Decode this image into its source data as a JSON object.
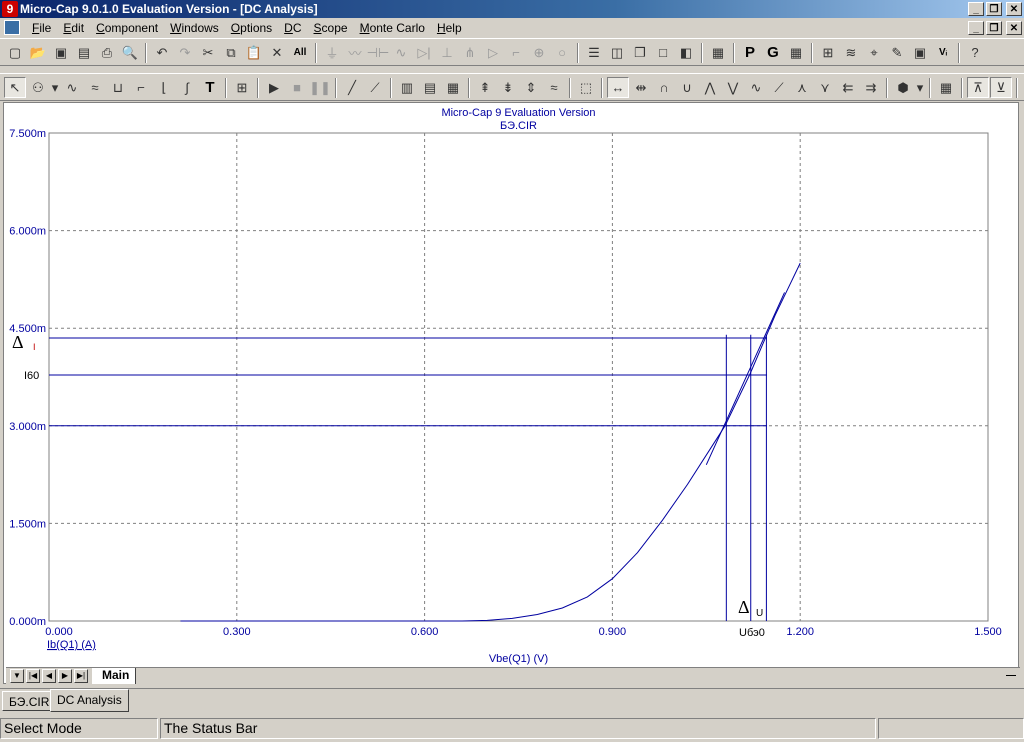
{
  "window": {
    "title": "Micro-Cap 9.0.1.0 Evaluation Version - [DC Analysis]",
    "app_icon_glyph": "9",
    "minimize_glyph": "_",
    "restore_glyph": "❐",
    "close_glyph": "✕"
  },
  "menu": {
    "items": [
      {
        "label": "File",
        "key": "F"
      },
      {
        "label": "Edit",
        "key": "E"
      },
      {
        "label": "Component",
        "key": "C"
      },
      {
        "label": "Windows",
        "key": "W"
      },
      {
        "label": "Options",
        "key": "O"
      },
      {
        "label": "DC",
        "key": "D"
      },
      {
        "label": "Scope",
        "key": "S"
      },
      {
        "label": "Monte Carlo",
        "key": "M"
      },
      {
        "label": "Help",
        "key": "H"
      }
    ]
  },
  "toolbar1": {
    "items": [
      "new-icon",
      "open-icon",
      "save-icon",
      "save-all-icon",
      "print-icon",
      "print-preview-icon",
      "sep",
      "undo-icon",
      "redo-icon",
      "cut-icon",
      "copy-icon",
      "paste-icon",
      "delete-icon",
      "select-all-icon",
      "sep",
      "ground-icon",
      "resistor-icon",
      "capacitor-icon",
      "inductor-icon",
      "diode-icon",
      "battery-icon",
      "npn-icon",
      "opamp-icon",
      "switch-icon",
      "source-icon",
      "wire-icon",
      "sep",
      "tile-h-icon",
      "tile-v-icon",
      "cascade-icon",
      "window-icon",
      "split-icon",
      "sep",
      "calculator-icon",
      "sep",
      "p-label-icon",
      "g-label-icon",
      "grid-icon",
      "sep",
      "components-icon",
      "waveform-icon",
      "probe-icon",
      "marker-icon",
      "snap-icon",
      "voltage-label-icon",
      "sep",
      "help-icon"
    ],
    "text_glyphs": {
      "p-label-icon": "P",
      "g-label-icon": "G",
      "voltage-label-icon": "Vᵢ",
      "select-all-icon": "All"
    }
  },
  "toolbar2": {
    "items": [
      "select-arrow-icon",
      "component-mode-icon",
      "dropdown-icon",
      "trace-icon",
      "multi-trace-icon",
      "scale-icon",
      "bode-icon",
      "xy-icon",
      "fourier-icon",
      "text-tool-icon",
      "sep",
      "properties-icon",
      "sep",
      "run-icon",
      "stop-icon",
      "pause-icon",
      "sep",
      "line-icon",
      "diagonal-icon",
      "sep",
      "table-icon",
      "table2-icon",
      "table3-icon",
      "sep",
      "cursor-left-icon",
      "cursor-right-icon",
      "cursor-both-icon",
      "wave-icon",
      "sep",
      "plot-icon",
      "sep",
      "h-cursor-icon",
      "v-cursor-icon",
      "peak-icon",
      "valley-icon",
      "high-icon",
      "low-icon",
      "inflection-icon",
      "slope-icon",
      "max-icon",
      "min-icon",
      "go-left-icon",
      "go-right-icon",
      "sep",
      "package-icon",
      "dropdown2-icon",
      "sep",
      "numeric-icon",
      "sep",
      "tag-h-icon",
      "tag-v-icon",
      "sep",
      "zoom-in-icon",
      "zoom-out-icon"
    ],
    "text_glyphs": {
      "text-tool-icon": "T"
    }
  },
  "chart_data": {
    "type": "line",
    "title": "Micro-Cap 9 Evaluation Version",
    "subtitle": "БЭ.CIR",
    "xlabel": "Vbe(Q1) (V)",
    "ylabel": "Ib(Q1) (A)",
    "xlim": [
      0,
      1.5
    ],
    "ylim": [
      0,
      0.0075
    ],
    "x_ticks": [
      0,
      0.3,
      0.6,
      0.9,
      1.2,
      1.5
    ],
    "x_tick_labels": [
      "0.000",
      "0.300",
      "0.600",
      "0.900",
      "1.200",
      "1.500"
    ],
    "y_ticks": [
      0,
      0.0015,
      0.003,
      0.0045,
      0.006,
      0.0075
    ],
    "y_tick_labels": [
      "0.000m",
      "1.500m",
      "3.000m",
      "4.500m",
      "6.000m",
      "7.500m"
    ],
    "grid": true,
    "series": [
      {
        "color": "#0000a0",
        "x": [
          0.21,
          0.66,
          0.7,
          0.74,
          0.78,
          0.82,
          0.86,
          0.9,
          0.94,
          0.98,
          1.02,
          1.06,
          1.08,
          1.1,
          1.12,
          1.14,
          1.16,
          1.18,
          1.2
        ],
        "y": [
          0,
          0,
          1e-05,
          4e-05,
          0.0001,
          0.0002,
          0.00037,
          0.00065,
          0.00105,
          0.00155,
          0.0021,
          0.0027,
          0.003,
          0.0034,
          0.0038,
          0.00425,
          0.0047,
          0.0051,
          0.0055
        ]
      }
    ],
    "tangent_line": {
      "x": [
        1.05,
        1.175
      ],
      "y": [
        0.0024,
        0.00505
      ]
    },
    "annotations": {
      "delta_i_label": "Δ",
      "delta_i_sub": "I",
      "i60_label": "I60",
      "delta_u_label": "Δ",
      "delta_u_sub": "U",
      "ubeo_label": "Uбэ0"
    },
    "guide_lines": {
      "h_levels": [
        0.00435,
        0.00378,
        0.003
      ],
      "v_positions": [
        1.082,
        1.121,
        1.146
      ]
    }
  },
  "scroll": {
    "main_tab_label": "Main"
  },
  "doc_tabs": [
    {
      "label": "БЭ.CIR"
    },
    {
      "label": "DC Analysis"
    }
  ],
  "status": {
    "mode": "Select Mode",
    "message": "The Status Bar"
  },
  "colors": {
    "plot_line": "#0000a0",
    "axis_text": "#0000a0",
    "grid": "#808080"
  }
}
